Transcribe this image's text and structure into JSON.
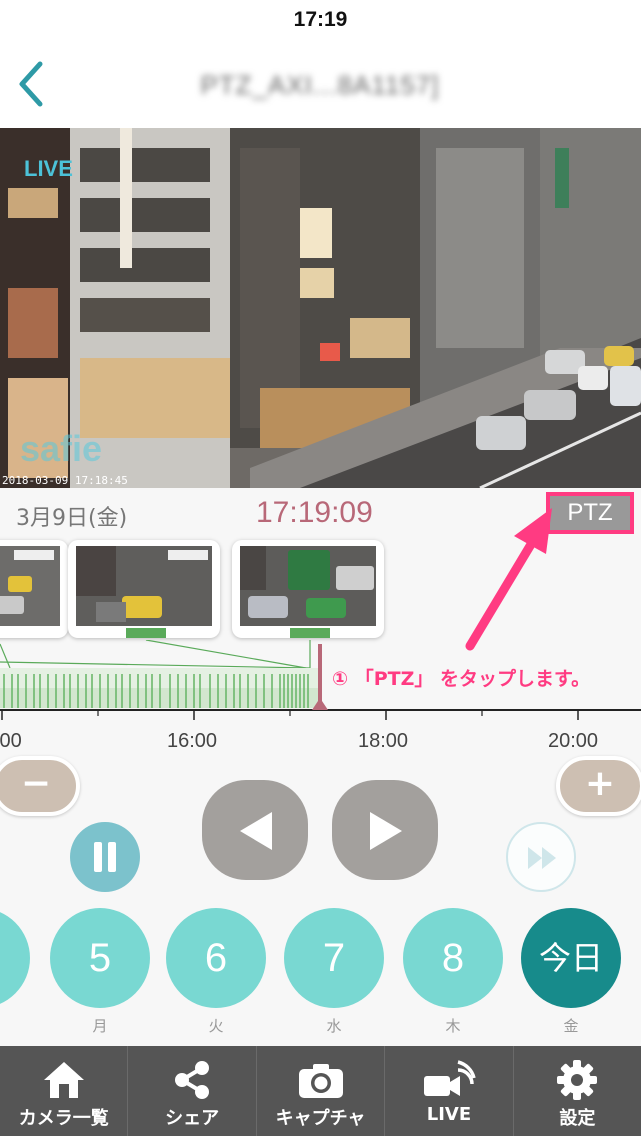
{
  "status_bar": {
    "time": "17:19"
  },
  "nav": {
    "title": "PTZ_AXI...8A1157]"
  },
  "camera": {
    "live_label": "LIVE",
    "timestamp": "2018-03-09 17:18:45",
    "watermark": "safie"
  },
  "date_row": {
    "date": "3月9日(金)",
    "time": "17:19:09",
    "ptz_label": "PTZ"
  },
  "annotation": "① 「PTZ」 をタップします。",
  "timeline": {
    "tick_labels": [
      ":00",
      "16:00",
      "18:00",
      "20:00"
    ]
  },
  "zoom": {
    "minus_label": "−",
    "plus_label": "+"
  },
  "days": [
    {
      "number": "5",
      "weekday": "月"
    },
    {
      "number": "6",
      "weekday": "火"
    },
    {
      "number": "7",
      "weekday": "水"
    },
    {
      "number": "8",
      "weekday": "木"
    },
    {
      "number": "今日",
      "weekday": "金"
    }
  ],
  "tabs": [
    {
      "label": "カメラ一覧",
      "icon": "home-icon"
    },
    {
      "label": "シェア",
      "icon": "share-icon"
    },
    {
      "label": "キャプチャ",
      "icon": "camera-icon"
    },
    {
      "label": "LIVE",
      "icon": "live-icon"
    },
    {
      "label": "設定",
      "icon": "gear-icon"
    }
  ],
  "colors": {
    "accent_teal": "#79d8d2",
    "today_teal": "#178b8b",
    "time_pink": "#b86878",
    "annotation_pink": "#ff3b82",
    "timeline_green": "#5aaa5a",
    "tab_bar": "#555555"
  }
}
